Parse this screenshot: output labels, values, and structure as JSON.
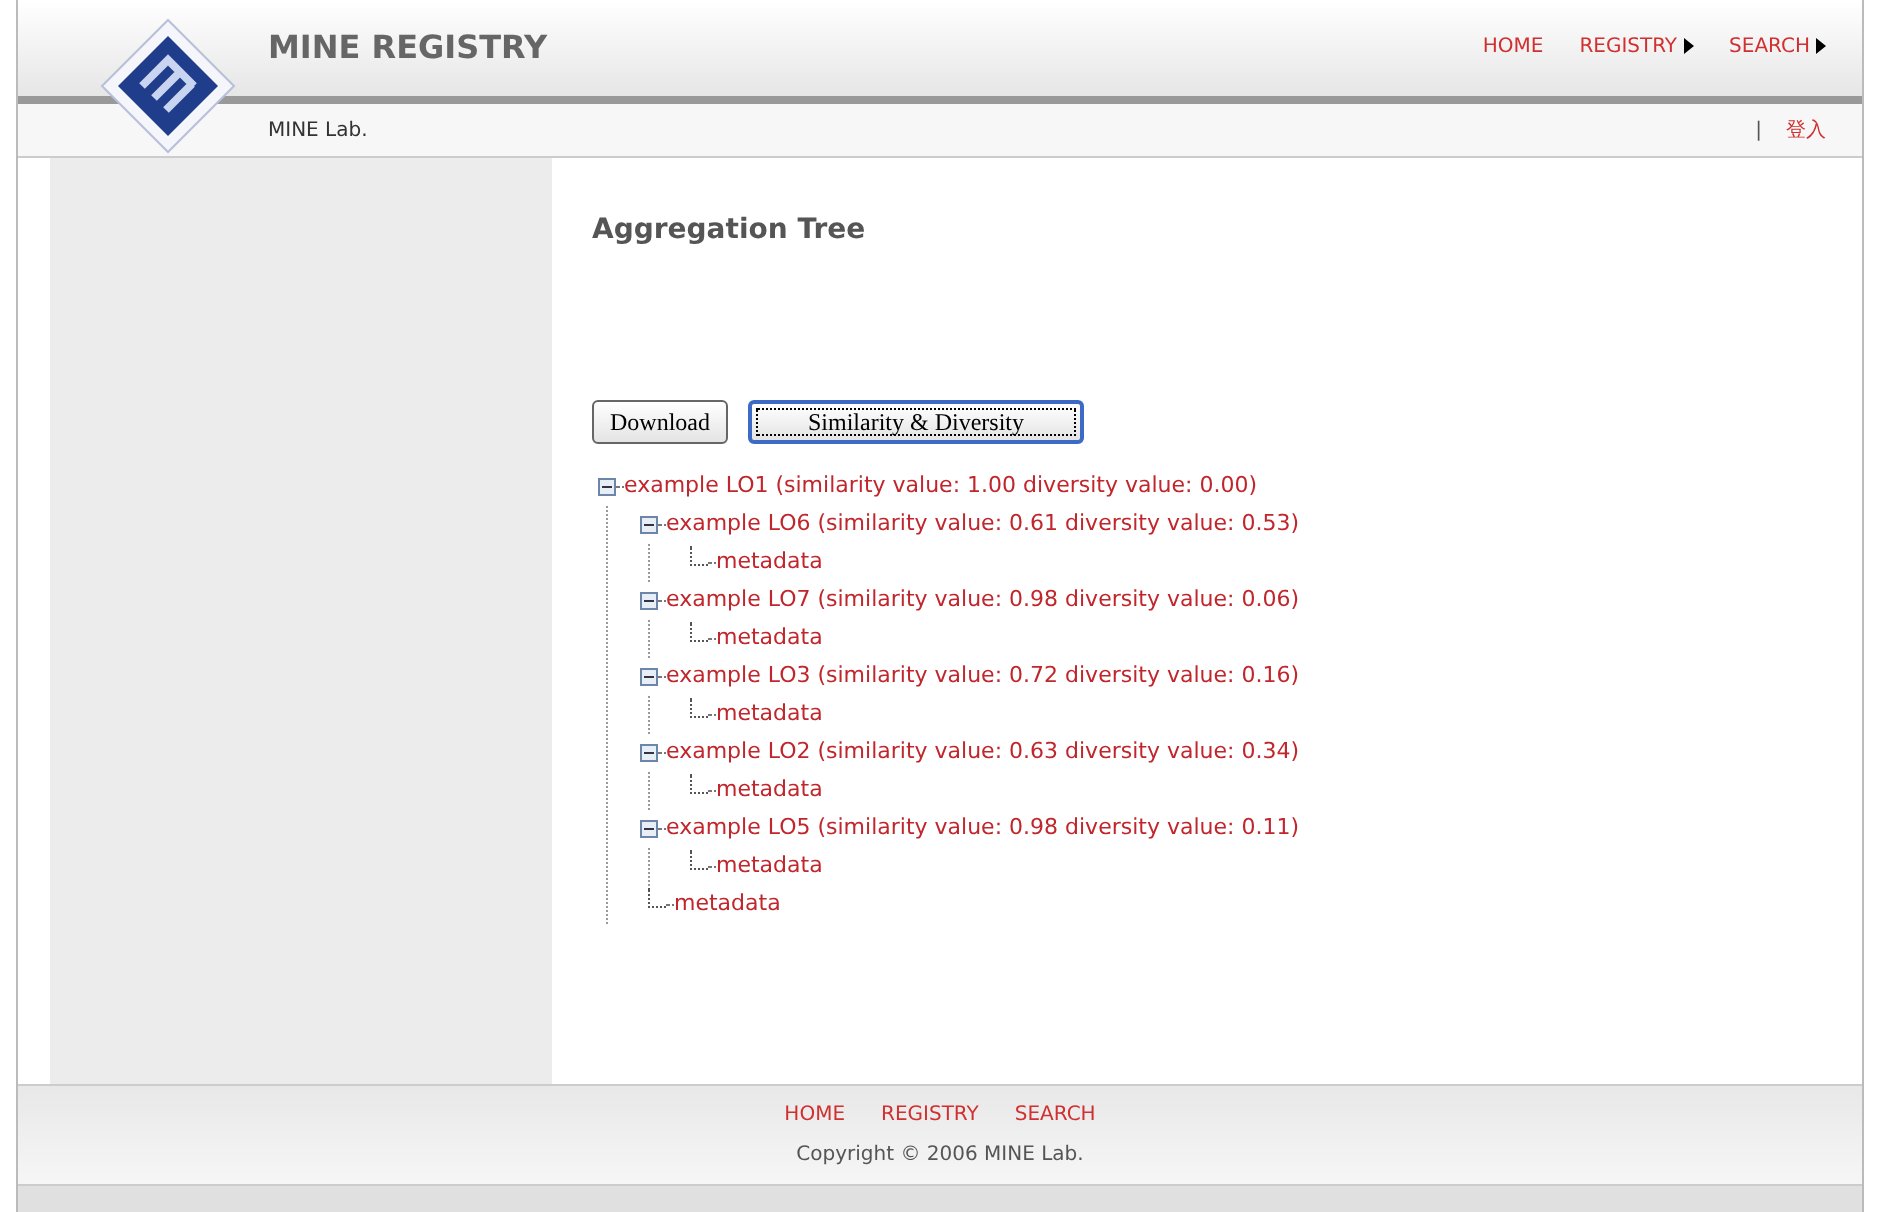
{
  "header": {
    "title": "MINE REGISTRY",
    "subtitle": "MINE Lab.",
    "nav": [
      {
        "label": "HOME",
        "has_menu": false
      },
      {
        "label": "REGISTRY",
        "has_menu": true
      },
      {
        "label": "SEARCH",
        "has_menu": true
      }
    ],
    "separator": "|",
    "login": "登入"
  },
  "page": {
    "heading": "Aggregation Tree",
    "buttons": [
      {
        "label": "Download",
        "focused": false
      },
      {
        "label": "Similarity & Diversity",
        "focused": true
      }
    ],
    "tree": [
      {
        "label": "example LO1 (similarity value: 1.00 diversity value: 0.00)",
        "expanded": true,
        "children": [
          {
            "label": "example LO6 (similarity value: 0.61 diversity value: 0.53)",
            "expanded": true,
            "children": [
              {
                "label": "metadata"
              }
            ]
          },
          {
            "label": "example LO7 (similarity value: 0.98 diversity value: 0.06)",
            "expanded": true,
            "children": [
              {
                "label": "metadata"
              }
            ]
          },
          {
            "label": "example LO3 (similarity value: 0.72 diversity value: 0.16)",
            "expanded": true,
            "children": [
              {
                "label": "metadata"
              }
            ]
          },
          {
            "label": "example LO2 (similarity value: 0.63 diversity value: 0.34)",
            "expanded": true,
            "children": [
              {
                "label": "metadata"
              }
            ]
          },
          {
            "label": "example LO5 (similarity value: 0.98 diversity value: 0.11)",
            "expanded": true,
            "children": [
              {
                "label": "metadata"
              }
            ]
          },
          {
            "label": "metadata"
          }
        ]
      }
    ]
  },
  "footer": {
    "links": [
      "HOME",
      "REGISTRY",
      "SEARCH"
    ],
    "copyright": "Copyright © 2006 MINE Lab."
  }
}
